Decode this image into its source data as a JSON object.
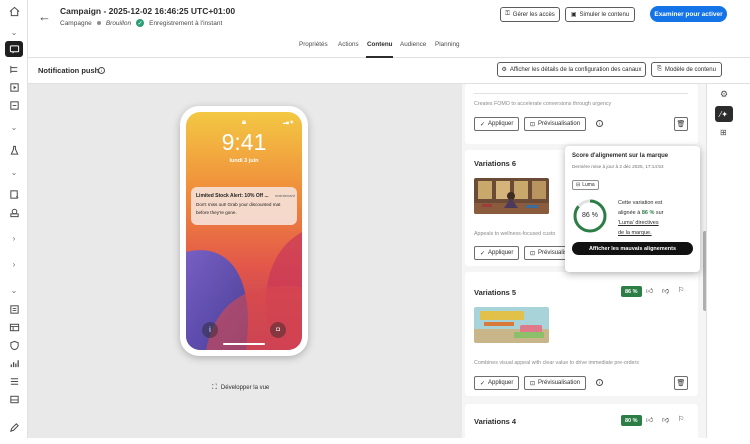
{
  "header": {
    "title": "Campaign - 2025-12-02 16:46:25 UTC+01:00",
    "breadcrumb": "Campagne",
    "status": "Brouillon",
    "save_status": "Enregistrement à l'instant",
    "manage_access": "Gérer les accès",
    "simulate": "Simuler le contenu",
    "review": "Examiner pour activer"
  },
  "tabs": [
    "Propriétés",
    "Actions",
    "Contenu",
    "Audience",
    "Planning"
  ],
  "active_tab": "Contenu",
  "toolbar": {
    "title": "Notification push",
    "show_config": "Afficher les détails de la configuration des canaux",
    "template": "Modèle de contenu"
  },
  "phone": {
    "time": "9:41",
    "date": "lundi 3 juin",
    "notif_title": "Limited Stock Alert: 10% Off ...",
    "notif_app": "maintenant",
    "notif_body": "Don't miss out! Grab your discounted mat before they're gone."
  },
  "expand_view": "Développer la vue",
  "panel": {
    "top_desc": "Creates FOMO to accelerate conversions through urgency",
    "apply": "Appliquer",
    "preview": "Prévisualisation",
    "variations": [
      {
        "title": "Variations 6",
        "desc": "Appeals to wellness-focused custo"
      },
      {
        "title": "Variations 5",
        "score": "86 %",
        "desc": "Combines visual appeal with clear value to drive immediate pre-orders"
      },
      {
        "title": "Variations 4",
        "score": "80 %"
      }
    ]
  },
  "popover": {
    "title": "Score d'alignement sur la marque",
    "updated": "Dernière mise à jour à 2 déc 2025, 17:14:53",
    "brand": "Luma",
    "score": "86 %",
    "score_value": 86,
    "text1": "Cette variation est",
    "text2a": "alignée à ",
    "text2b": "86 %",
    "text2c": " sur",
    "link1": "'Luma' directives",
    "link2": "de la marque.",
    "button": "Afficher les mauvais alignements"
  },
  "colors": {
    "accent": "#1473e6",
    "score_green": "#2d7d46"
  }
}
